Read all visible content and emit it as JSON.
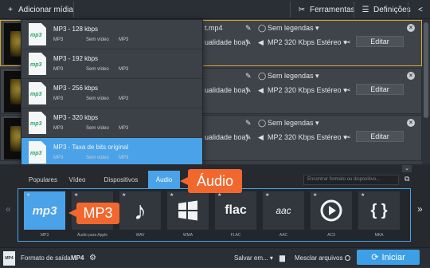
{
  "toolbar": {
    "add_media": "Adicionar mídia",
    "tools": "Ferramentas",
    "settings": "Definições"
  },
  "files": [
    {
      "name_fragment": "t.mp4",
      "subtitles": "Sem legendas",
      "quality_fragment": "ualidade boa)",
      "audio": "MP2 320 Kbps Estéreo",
      "edit": "Editar",
      "selected": true
    },
    {
      "name_fragment": "",
      "subtitles": "Sem legendas",
      "quality_fragment": "ualidade boa)",
      "audio": "MP2 320 Kbps Estéreo",
      "edit": "Editar",
      "selected": false
    },
    {
      "name_fragment": "",
      "subtitles": "Sem legendas",
      "quality_fragment": "ualidade boa)",
      "audio": "MP2 320 Kbps Estéreo",
      "edit": "Editar",
      "selected": false
    }
  ],
  "dropdown": [
    {
      "title": "MP3 - 128 kbps",
      "codec": "MP3",
      "video": "Sem vídeo",
      "format": "MP3"
    },
    {
      "title": "MP3 - 192 kbps",
      "codec": "MP3",
      "video": "Sem vídeo",
      "format": "MP3"
    },
    {
      "title": "MP3 - 256 kbps",
      "codec": "MP3",
      "video": "Sem vídeo",
      "format": "MP3"
    },
    {
      "title": "MP3 - 320 kbps",
      "codec": "MP3",
      "video": "Sem vídeo",
      "format": "MP3"
    },
    {
      "title": "MP3 - Taxa de bits original",
      "codec": "MP3",
      "video": "Sem vídeo",
      "format": "MP3",
      "active": true
    }
  ],
  "file_icon_label": "mp3",
  "tabs": [
    "Populares",
    "Vídeo",
    "Dispositivos",
    "Áudio"
  ],
  "active_tab": "Áudio",
  "search_placeholder": "Encontrar formato ou dispositivo...",
  "formats": [
    {
      "label": "MP3",
      "icon": "mp3"
    },
    {
      "label": "Áudio para Apple",
      "icon": ""
    },
    {
      "label": "WAV",
      "icon": "music-note-icon"
    },
    {
      "label": "WMA",
      "icon": "windows-logo-icon"
    },
    {
      "label": "FLAC",
      "icon": "flac"
    },
    {
      "label": "AAC",
      "icon": "aac"
    },
    {
      "label": "AC3",
      "icon": "play-circle-icon"
    },
    {
      "label": "MKA",
      "icon": "matroska-icon"
    }
  ],
  "callouts": {
    "audio_tab": "Áudio",
    "mp3_tile": "MP3"
  },
  "bottom": {
    "output_label": "Formato de saída:",
    "output_value": "MP4",
    "format_badge": "MP4",
    "save_to": "Salvar em...",
    "merge": "Mesclar arquivos",
    "start": "Iniciar"
  },
  "colors": {
    "accent": "#4aa2e8",
    "callout": "#f2672e",
    "selected_border": "#d8a430"
  }
}
